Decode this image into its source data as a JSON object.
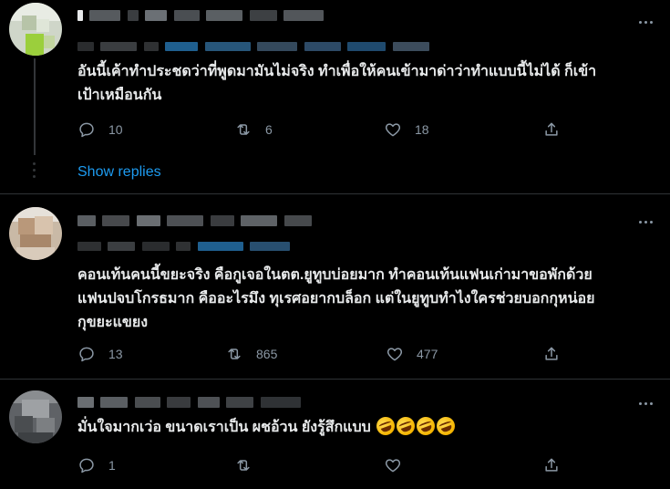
{
  "tweets": [
    {
      "text_lines": [
        "อันนี้เค้าทำประชดว่าที่พูดมามันไม่จริง ทำเพื่อให้คนเข้ามาด่าว่าทำแบบนี้ไม่ได้ ก็เข้า",
        "เป้าเหมือนกัน"
      ],
      "reply_count": "10",
      "retweet_count": "6",
      "like_count": "18",
      "avatar_icon": "blurred-avatar",
      "show_replies_label": "Show replies"
    },
    {
      "text_lines": [
        "คอนเท้นคนนี้ขยะจริง คือกูเจอในตต.ยูทูบบ่อยมาก ทำคอนเท้นแฟนเก่ามาขอพักด้วย",
        "แฟนปจบโกรธมาก คืออะไรมึง ทุเรศอยากบล็อก แต่ในยูทูบทำไงใครช่วยบอกกุหน่อย",
        "กุขยะแขยง"
      ],
      "reply_count": "13",
      "retweet_count": "865",
      "like_count": "477",
      "avatar_icon": "blurred-avatar"
    },
    {
      "text": "มั่นใจมากเว่อ ขนาดเราเป็น ผชอ้วน ยังรู้สึกแบบ",
      "emoji_icons": [
        "rofl-emoji",
        "rofl-emoji",
        "rofl-emoji",
        "rofl-emoji"
      ],
      "reply_count": "1",
      "avatar_icon": "blurred-avatar"
    }
  ],
  "colors": {
    "background": "#000000",
    "text": "#e7e9ea",
    "muted": "#8b98a5",
    "link": "#1d9bf0",
    "divider": "#2f3336"
  }
}
